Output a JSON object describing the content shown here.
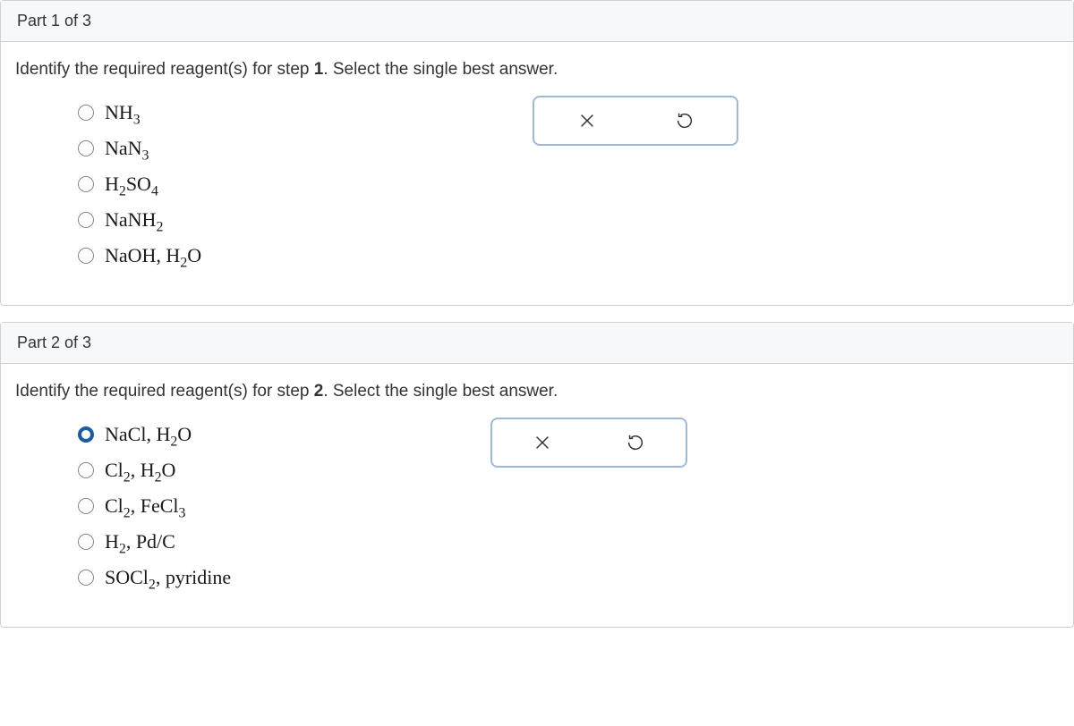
{
  "part1": {
    "header": "Part 1 of 3",
    "question_prefix": "Identify the required reagent(s) for step ",
    "question_step": "1",
    "question_suffix": ". Select the single best answer.",
    "options": {
      "opt1_html": "NH<sub>3</sub>",
      "opt2_html": "NaN<sub>3</sub>",
      "opt3_html": "H<sub>2</sub>SO<sub>4</sub>",
      "opt4_html": "NaNH<sub>2</sub>",
      "opt5_html": "NaOH, H<sub>2</sub>O"
    }
  },
  "part2": {
    "header": "Part 2 of 3",
    "question_prefix": "Identify the required reagent(s) for step ",
    "question_step": "2",
    "question_suffix": ". Select the single best answer.",
    "options": {
      "opt1_html": "NaCl, H<sub>2</sub>O",
      "opt2_html": "Cl<sub>2</sub>, H<sub>2</sub>O",
      "opt3_html": "Cl<sub>2</sub>, FeCl<sub>3</sub>",
      "opt4_html": "H<sub>2</sub>, Pd/C",
      "opt5_html": "SOCl<sub>2</sub>, pyridine"
    }
  },
  "icons": {
    "close": "close-icon",
    "reset": "reset-icon"
  }
}
